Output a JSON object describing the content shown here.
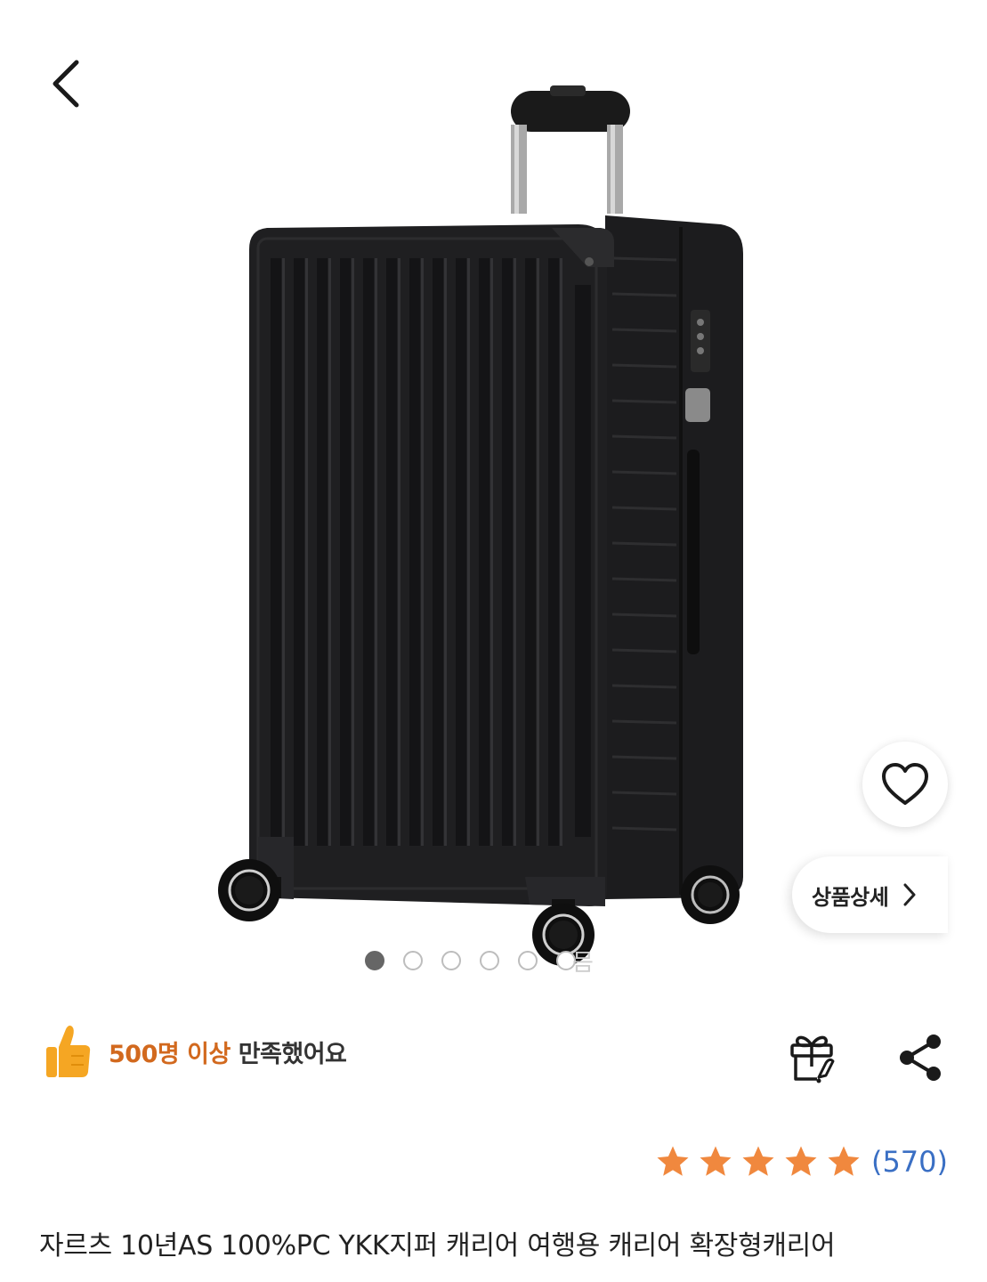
{
  "product": {
    "title": "자르츠 10년AS 100%PC YKK지퍼 캐리어 여행용 캐리어 확장형캐리어",
    "image_alt": "black hardshell suitcase"
  },
  "gallery": {
    "total_dots": 6,
    "active_index": 0,
    "tail_glyph": "믐"
  },
  "actions": {
    "detail_label": "상품상세"
  },
  "satisfaction": {
    "highlight": "500명 이상",
    "rest": "만족했어요"
  },
  "rating": {
    "stars": 5,
    "max_stars": 5,
    "review_count": "(570)",
    "star_color": "#f0883e"
  },
  "icons": {
    "back": "chevron-left-icon",
    "wishlist": "heart-outline-icon",
    "detail": "chevron-right-icon",
    "satisfaction": "thumbs-up-icon",
    "gift": "gift-icon",
    "share": "share-icon"
  },
  "colors": {
    "highlight": "#d2691e",
    "review_count": "#3a6fc4",
    "thumb": "#f5a623"
  }
}
